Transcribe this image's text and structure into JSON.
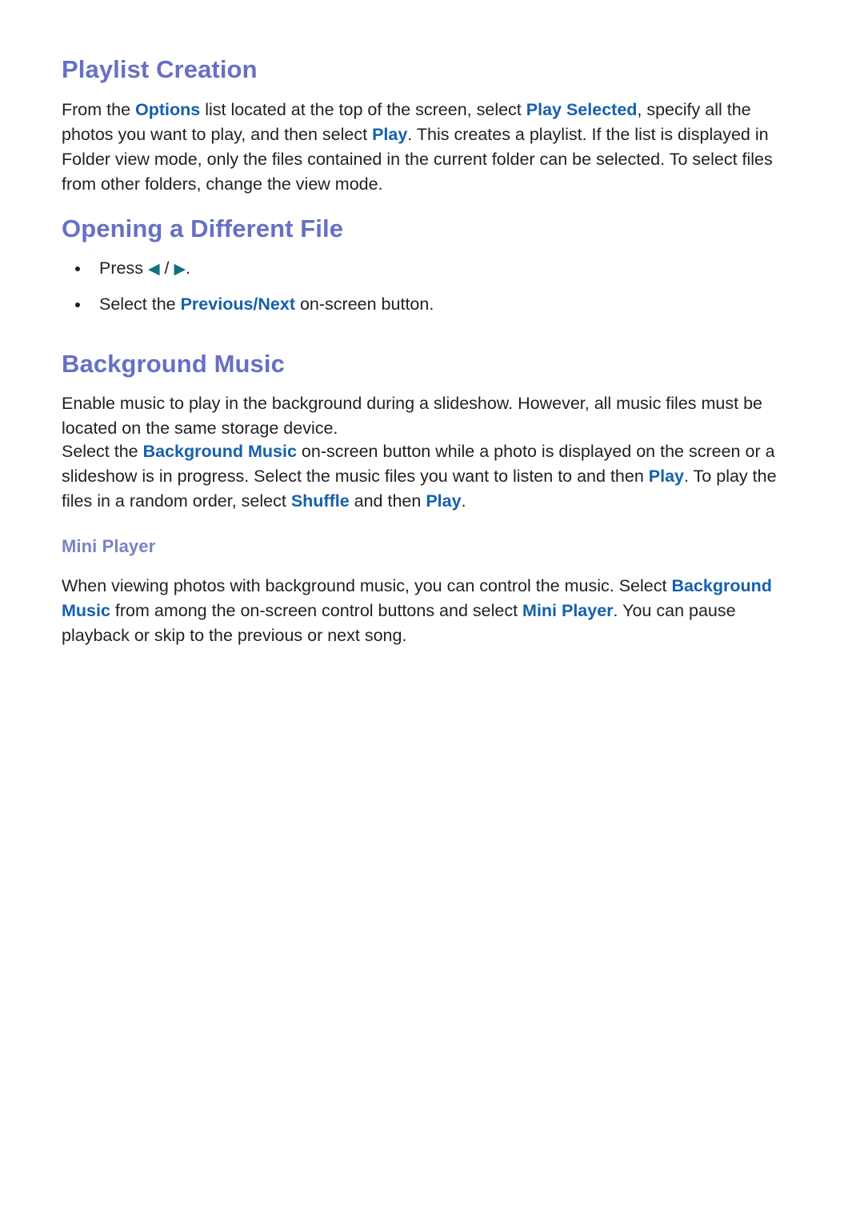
{
  "page": {
    "background_color": "#ffffff",
    "heading_color": "#6670c4",
    "subheading_color": "#7b82c6",
    "highlight_color": "#1560ad",
    "arrow_color": "#14707f",
    "body_text_color": "#231f20"
  },
  "sections": {
    "playlist_creation": {
      "title": "Playlist Creation",
      "paragraph": {
        "p1": "From the ",
        "t1": "Options",
        "p2": " list located at the top of the screen, select ",
        "t2": "Play Selected",
        "p3": ", specify all the photos you want to play, and then select ",
        "t3": "Play",
        "p4": ". This creates a playlist. If the list is displayed in Folder view mode, only the files contained in the current folder can be selected. To select files from other folders, change the view mode."
      }
    },
    "opening_a_different_file": {
      "title": "Opening a Different File",
      "bullets": {
        "b1": {
          "p1": "Press ",
          "left_arrow": "◀",
          "separator": " / ",
          "right_arrow": "▶",
          "p2": "."
        },
        "b2": {
          "p1": "Select the ",
          "t1": "Previous/Next",
          "p2": " on-screen button."
        }
      }
    },
    "background_music": {
      "title": "Background Music",
      "paragraph1": "Enable music to play in the background during a slideshow. However, all music files must be located on the same storage device.",
      "paragraph2": {
        "p1": "Select the ",
        "t1": "Background Music",
        "p2": " on-screen button while a photo is displayed on the screen or a slideshow is in progress. Select the music files you want to listen to and then ",
        "t2": "Play",
        "p3": ". To play the files in a random order, select ",
        "t3": "Shuffle",
        "p4": " and then ",
        "t4": "Play",
        "p5": "."
      },
      "mini_player": {
        "title": "Mini Player",
        "paragraph": {
          "p1": "When viewing photos with background music, you can control the music. Select ",
          "t1": "Background Music",
          "p2": " from among the on-screen control buttons and select ",
          "t2": "Mini Player",
          "p3": ". You can pause playback or skip to the previous or next song."
        }
      }
    }
  }
}
